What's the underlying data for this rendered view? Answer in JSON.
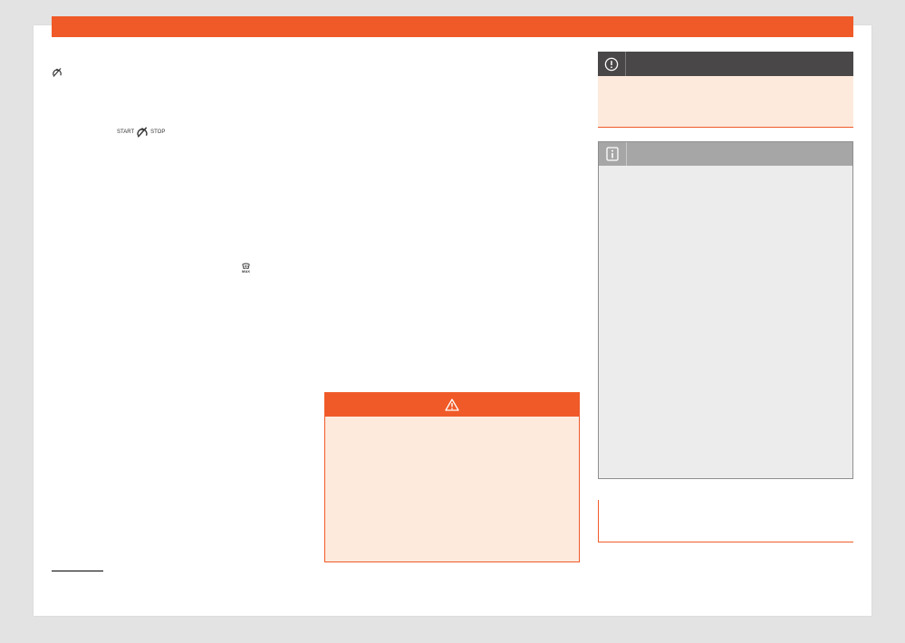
{
  "colors": {
    "accent": "#f05a28",
    "warning_background": "#fdeadd",
    "caution_header": "#4a4748",
    "info_background": "#ececec",
    "info_header": "#a7a6a6"
  },
  "inline_symbols": {
    "start_stop_left": "START",
    "start_stop_right": "STOP",
    "defrost_label": "MAX"
  },
  "icons": {
    "start_stop": "start-stop-off-icon",
    "defrost": "windscreen-defrost-max-icon",
    "warning": "warning-triangle-icon",
    "caution": "exclamation-circle-icon",
    "info": "info-icon"
  }
}
